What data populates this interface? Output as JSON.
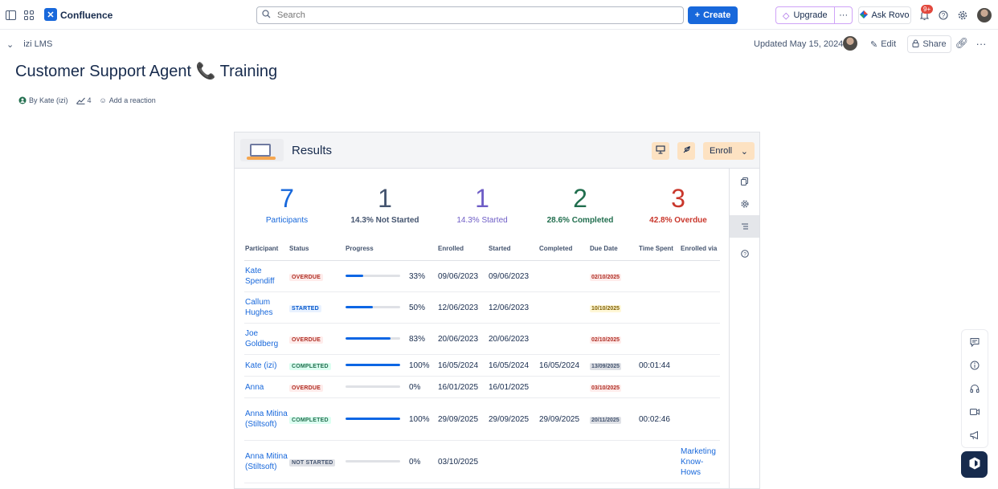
{
  "topbar": {
    "app_name": "Confluence",
    "search_placeholder": "Search",
    "create_label": "Create",
    "upgrade_label": "Upgrade",
    "more_label": "···",
    "rovo_label": "Ask Rovo",
    "notifications_badge": "9+"
  },
  "page": {
    "breadcrumb": "izi LMS",
    "updated": "Updated May 15, 2024",
    "edit_label": "Edit",
    "share_label": "Share",
    "title": "Customer Support Agent 📞 Training",
    "author": "By Kate (izi)",
    "views": "4",
    "reaction_label": "Add a reaction"
  },
  "macro": {
    "title": "Results",
    "enroll_label": "Enroll",
    "stats": [
      {
        "number": "7",
        "label": "Participants",
        "color": "#1868db"
      },
      {
        "number": "1",
        "label": "14.3% Not Started",
        "color": "#44546f"
      },
      {
        "number": "1",
        "label": "14.3% Started",
        "color": "#6e5dc6"
      },
      {
        "number": "2",
        "label": "28.6% Completed",
        "color": "#216e4e"
      },
      {
        "number": "3",
        "label": "42.8% Overdue",
        "color": "#c9372c"
      }
    ],
    "columns": {
      "participant": "Participant",
      "status": "Status",
      "progress": "Progress",
      "enrolled": "Enrolled",
      "started": "Started",
      "completed": "Completed",
      "due_date": "Due Date",
      "time_spent": "Time Spent",
      "enrolled_via": "Enrolled via"
    },
    "rows": [
      {
        "name": "Kate Spendiff",
        "status": "OVERDUE",
        "status_type": "overdue",
        "progress": 33,
        "progress_label": "33%",
        "enrolled": "09/06/2023",
        "started": "09/06/2023",
        "completed": "",
        "due": "02/10/2025",
        "due_type": "red",
        "time": "",
        "via": ""
      },
      {
        "name": "Callum Hughes",
        "status": "STARTED",
        "status_type": "started",
        "progress": 50,
        "progress_label": "50%",
        "enrolled": "12/06/2023",
        "started": "12/06/2023",
        "completed": "",
        "due": "10/10/2025",
        "due_type": "amber",
        "time": "",
        "via": ""
      },
      {
        "name": "Joe Goldberg",
        "status": "OVERDUE",
        "status_type": "overdue",
        "progress": 83,
        "progress_label": "83%",
        "enrolled": "20/06/2023",
        "started": "20/06/2023",
        "completed": "",
        "due": "02/10/2025",
        "due_type": "red",
        "time": "",
        "via": ""
      },
      {
        "name": "Kate (izi)",
        "status": "COMPLETED",
        "status_type": "completed",
        "progress": 100,
        "progress_label": "100%",
        "enrolled": "16/05/2024",
        "started": "16/05/2024",
        "completed": "16/05/2024",
        "due": "13/09/2025",
        "due_type": "gray",
        "time": "00:01:44",
        "via": ""
      },
      {
        "name": "Anna",
        "status": "OVERDUE",
        "status_type": "overdue",
        "progress": 0,
        "progress_label": "0%",
        "enrolled": "16/01/2025",
        "started": "16/01/2025",
        "completed": "",
        "due": "03/10/2025",
        "due_type": "red",
        "time": "",
        "via": ""
      },
      {
        "name": "Anna Mitina (Stiltsoft)",
        "status": "COMPLETED",
        "status_type": "completed",
        "progress": 100,
        "progress_label": "100%",
        "enrolled": "29/09/2025",
        "started": "29/09/2025",
        "completed": "29/09/2025",
        "due": "20/11/2025",
        "due_type": "gray",
        "time": "00:02:46",
        "via": ""
      },
      {
        "name": "Anna Mitina (Stiltsoft)",
        "status": "NOT STARTED",
        "status_type": "notstarted",
        "progress": 0,
        "progress_label": "0%",
        "enrolled": "03/10/2025",
        "started": "",
        "completed": "",
        "due": "",
        "due_type": "",
        "time": "",
        "via": "Marketing Know-Hows"
      }
    ]
  }
}
